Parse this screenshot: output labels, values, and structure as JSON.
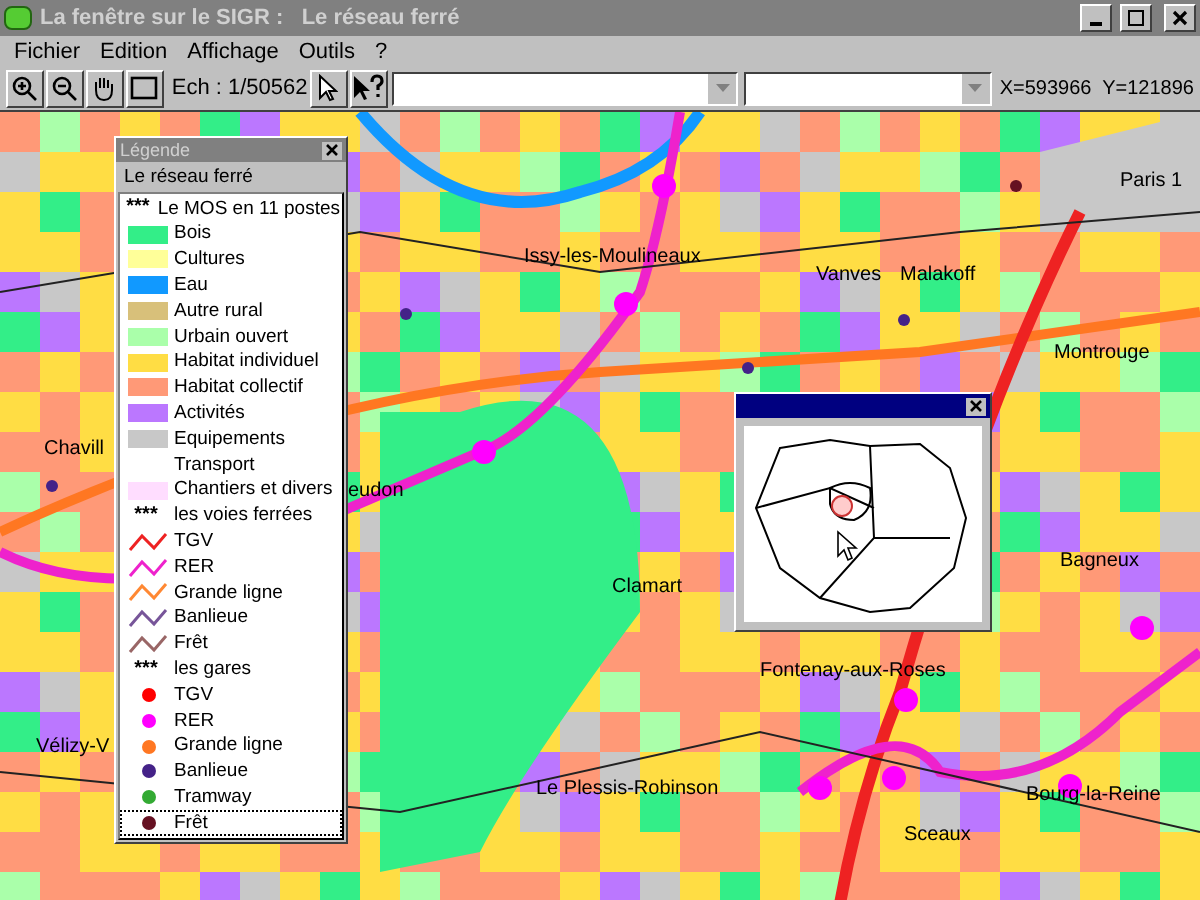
{
  "window": {
    "title": "La fenêtre sur le SIGR :   Le réseau ferré"
  },
  "menu": [
    "Fichier",
    "Edition",
    "Affichage",
    "Outils",
    "?"
  ],
  "toolbar": {
    "scale": "Ech : 1/50562",
    "coords": "X=593966  Y=121896"
  },
  "map_labels": [
    "Paris 1",
    "Issy-les-Moulineaux",
    "Vanves",
    "Malakoff",
    "Montrouge",
    "Chavill",
    "eudon",
    "Clamart",
    "Bagneux",
    "Fontenay-aux-Roses",
    "Vélizy-V",
    "Le Plessis-Robinson",
    "Bourg-la-Reine",
    "Sceaux"
  ],
  "legend": {
    "title": "Légende",
    "layer": "Le réseau ferré",
    "items": [
      {
        "kind": "header",
        "marker": "***",
        "label": "Le MOS en 11 postes",
        "selected": false
      },
      {
        "kind": "swatch",
        "label": "Bois",
        "color": "#33ee88",
        "selected": false
      },
      {
        "kind": "swatch",
        "label": "Cultures",
        "color": "#ffff99",
        "selected": false
      },
      {
        "kind": "swatch",
        "label": "Eau",
        "color": "#1199ff",
        "selected": false
      },
      {
        "kind": "swatch",
        "label": "Autre rural",
        "color": "#d8c07a",
        "selected": false
      },
      {
        "kind": "swatch",
        "label": "Urbain ouvert",
        "color": "#aaffaa",
        "selected": false
      },
      {
        "kind": "swatch",
        "label": "Habitat individuel",
        "color": "#ffdd44",
        "selected": false
      },
      {
        "kind": "swatch",
        "label": "Habitat collectif",
        "color": "#ff9977",
        "selected": false
      },
      {
        "kind": "swatch",
        "label": "Activités",
        "color": "#bb77ff",
        "selected": false
      },
      {
        "kind": "swatch",
        "label": "Equipements",
        "color": "#c8c8c8",
        "selected": false
      },
      {
        "kind": "plain",
        "label": "Transport",
        "selected": false
      },
      {
        "kind": "swatch",
        "label": "Chantiers et divers",
        "color": "#ffddff",
        "selected": false
      },
      {
        "kind": "header",
        "marker": "***",
        "label": "les voies ferrées",
        "selected": false
      },
      {
        "kind": "line",
        "label": "TGV",
        "color": "#ee2222",
        "selected": false
      },
      {
        "kind": "line",
        "label": "RER",
        "color": "#ee22cc",
        "selected": false
      },
      {
        "kind": "line",
        "label": "Grande ligne",
        "color": "#ff8833",
        "selected": false
      },
      {
        "kind": "line",
        "label": "Banlieue",
        "color": "#775599",
        "selected": false
      },
      {
        "kind": "line",
        "label": "Frêt",
        "color": "#996666",
        "selected": false
      },
      {
        "kind": "header",
        "marker": "***",
        "label": "les gares",
        "selected": false
      },
      {
        "kind": "dot",
        "label": "TGV",
        "color": "#ff0000",
        "selected": false
      },
      {
        "kind": "dot",
        "label": "RER",
        "color": "#ff00ff",
        "selected": false
      },
      {
        "kind": "dot",
        "label": "Grande ligne",
        "color": "#ff7722",
        "selected": false
      },
      {
        "kind": "dot",
        "label": "Banlieue",
        "color": "#442288",
        "selected": false
      },
      {
        "kind": "dot",
        "label": "Tramway",
        "color": "#33aa33",
        "selected": false
      },
      {
        "kind": "dot",
        "label": "Frêt",
        "color": "#661122",
        "selected": true
      }
    ]
  }
}
